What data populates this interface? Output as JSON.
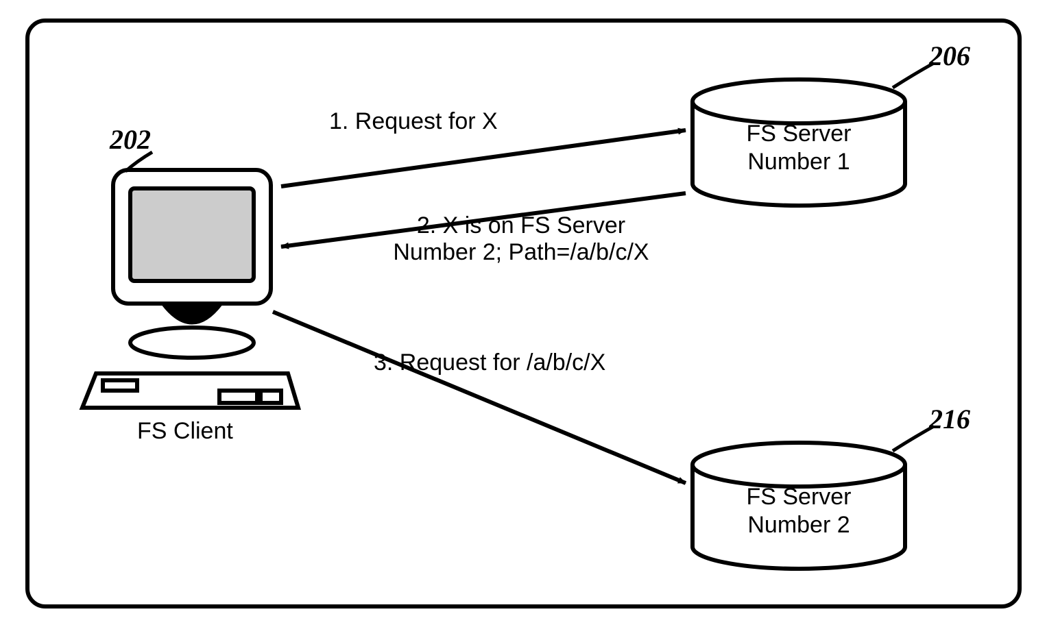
{
  "refs": {
    "client": "202",
    "server1": "206",
    "server2": "216"
  },
  "labels": {
    "client": "FS Client",
    "server1_line1": "FS Server",
    "server1_line2": "Number 1",
    "server2_line1": "FS Server",
    "server2_line2": "Number 2"
  },
  "messages": {
    "m1": "1. Request for X",
    "m2_line1": "2. X is on FS Server",
    "m2_line2": "Number 2; Path=/a/b/c/X",
    "m3": "3. Request for /a/b/c/X"
  }
}
